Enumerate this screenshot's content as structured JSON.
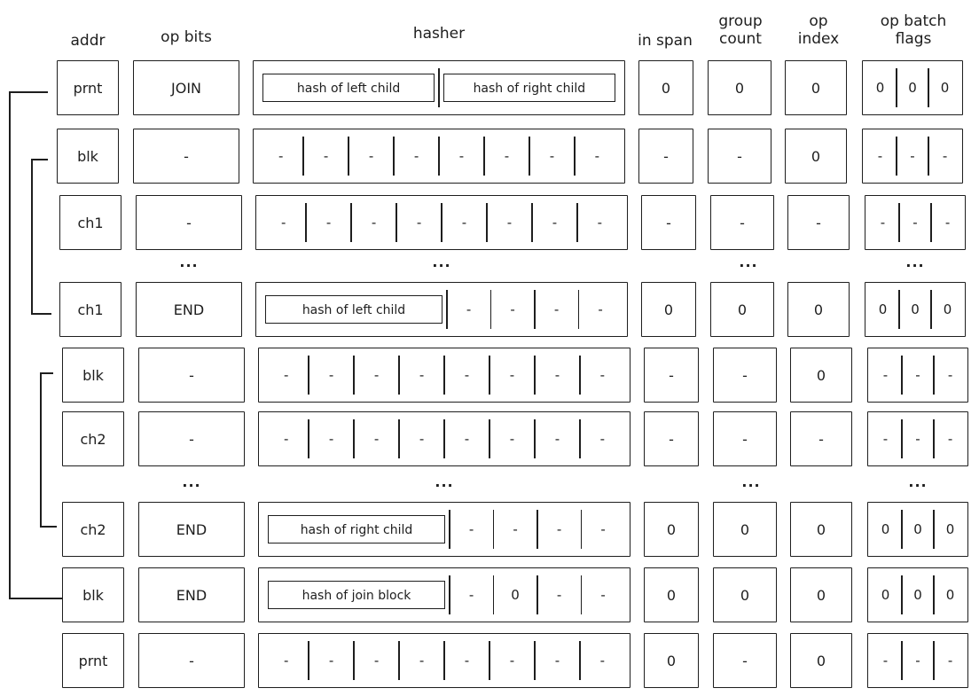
{
  "headers": {
    "addr": "addr",
    "op_bits": "op bits",
    "hasher": "hasher",
    "in_span": "in span",
    "group_count": "group count",
    "op_index": "op index",
    "op_batch_flags": "op batch flags"
  },
  "dots": "...",
  "rows": [
    {
      "addr": "prnt",
      "op_bits": "JOIN",
      "hash_boxes": [
        "hash of left child",
        "hash of right child"
      ],
      "hasher": [],
      "in_span": "0",
      "group_count": "0",
      "op_index": "0",
      "flags": [
        "0",
        "0",
        "0"
      ]
    },
    {
      "addr": "blk",
      "op_bits": "-",
      "hash_boxes": [],
      "hasher": [
        "-",
        "-",
        "-",
        "-",
        "-",
        "-",
        "-",
        "-"
      ],
      "in_span": "-",
      "group_count": "-",
      "op_index": "0",
      "flags": [
        "-",
        "-",
        "-"
      ]
    },
    {
      "addr": "ch1",
      "op_bits": "-",
      "hash_boxes": [],
      "hasher": [
        "-",
        "-",
        "-",
        "-",
        "-",
        "-",
        "-",
        "-"
      ],
      "in_span": "-",
      "group_count": "-",
      "op_index": "-",
      "flags": [
        "-",
        "-",
        "-"
      ]
    },
    {
      "dots_row": true
    },
    {
      "addr": "ch1",
      "op_bits": "END",
      "hash_boxes": [
        "hash of left child"
      ],
      "hasher": [
        "-",
        "-",
        "-",
        "-"
      ],
      "in_span": "0",
      "group_count": "0",
      "op_index": "0",
      "flags": [
        "0",
        "0",
        "0"
      ]
    },
    {
      "addr": "blk",
      "op_bits": "-",
      "hash_boxes": [],
      "hasher": [
        "-",
        "-",
        "-",
        "-",
        "-",
        "-",
        "-",
        "-"
      ],
      "in_span": "-",
      "group_count": "-",
      "op_index": "0",
      "flags": [
        "-",
        "-",
        "-"
      ]
    },
    {
      "addr": "ch2",
      "op_bits": "-",
      "hash_boxes": [],
      "hasher": [
        "-",
        "-",
        "-",
        "-",
        "-",
        "-",
        "-",
        "-"
      ],
      "in_span": "-",
      "group_count": "-",
      "op_index": "-",
      "flags": [
        "-",
        "-",
        "-"
      ]
    },
    {
      "dots_row": true
    },
    {
      "addr": "ch2",
      "op_bits": "END",
      "hash_boxes": [
        "hash of right child"
      ],
      "hasher": [
        "-",
        "-",
        "-",
        "-"
      ],
      "in_span": "0",
      "group_count": "0",
      "op_index": "0",
      "flags": [
        "0",
        "0",
        "0"
      ]
    },
    {
      "addr": "blk",
      "op_bits": "END",
      "hash_boxes": [
        "hash of join block"
      ],
      "hasher": [
        "-",
        "0",
        "-",
        "-"
      ],
      "in_span": "0",
      "group_count": "0",
      "op_index": "0",
      "flags": [
        "0",
        "0",
        "0"
      ]
    },
    {
      "addr": "prnt",
      "op_bits": "-",
      "hash_boxes": [],
      "hasher": [
        "-",
        "-",
        "-",
        "-",
        "-",
        "-",
        "-",
        "-"
      ],
      "in_span": "0",
      "group_count": "-",
      "op_index": "0",
      "flags": [
        "-",
        "-",
        "-"
      ]
    }
  ]
}
